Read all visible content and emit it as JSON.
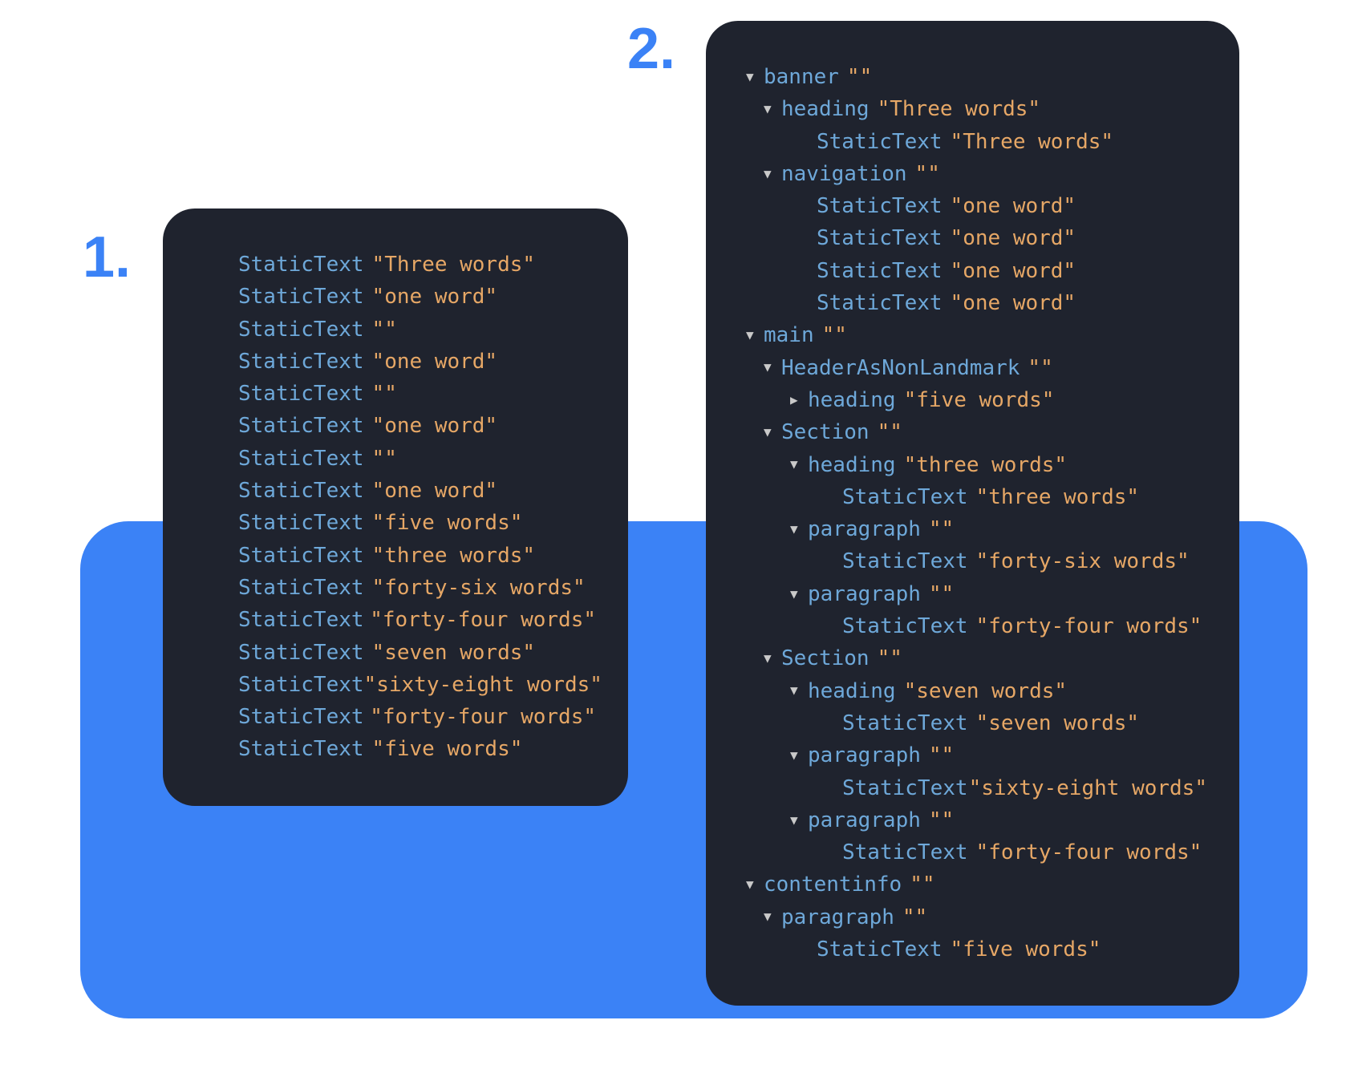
{
  "labels": {
    "one": "1.",
    "two": "2."
  },
  "glyphs": {
    "down": "▼",
    "right": "▶"
  },
  "roles": {
    "staticText": "StaticText",
    "banner": "banner",
    "heading": "heading",
    "navigation": "navigation",
    "main": "main",
    "headerNonLandmark": "HeaderAsNonLandmark",
    "section": "Section",
    "paragraph": "paragraph",
    "contentinfo": "contentinfo"
  },
  "vals": {
    "empty": "\"\"",
    "threeWordsCap": "\"Three words\"",
    "oneWord": "\"one word\"",
    "fiveWords": "\"five words\"",
    "threeWords": "\"three words\"",
    "fortySix": "\"forty-six words\"",
    "fortyFour": "\"forty-four words\"",
    "sevenWords": "\"seven words\"",
    "sixtyEight": "\"sixty-eight words\""
  }
}
